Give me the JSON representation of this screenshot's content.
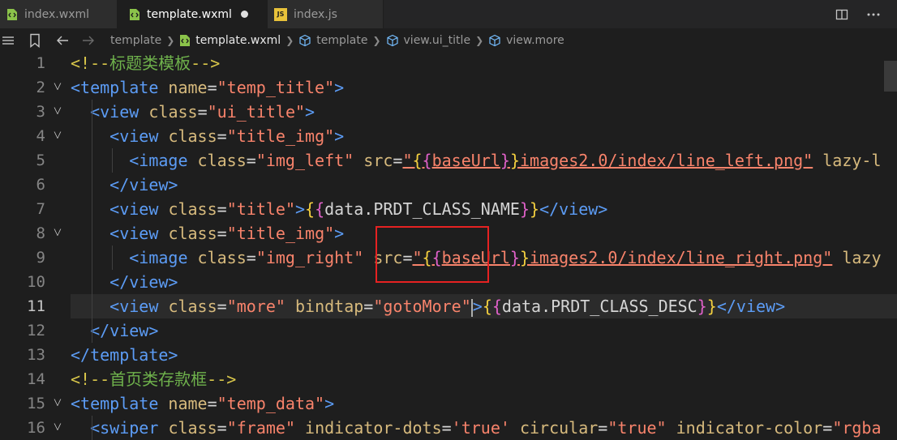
{
  "tabs": [
    {
      "label": "index.wxml",
      "icon": "wxml-file-icon",
      "active": false,
      "modified": false
    },
    {
      "label": "template.wxml",
      "icon": "wxml-file-icon",
      "active": true,
      "modified": true
    },
    {
      "label": "index.js",
      "icon": "js-file-icon",
      "active": false,
      "modified": false
    }
  ],
  "js_badge": "JS",
  "breadcrumb": {
    "items": [
      "template",
      "template.wxml",
      "template",
      "view.ui_title",
      "view.more"
    ]
  },
  "editor": {
    "current_line": 11,
    "lines": [
      {
        "n": "1",
        "tokens": [
          [
            "cmt",
            "<!--"
          ],
          [
            "cmtzh",
            "标题类模板"
          ],
          [
            "cmt",
            "-->"
          ]
        ]
      },
      {
        "n": "2",
        "fold": true,
        "tokens": [
          [
            "tag",
            "<template"
          ],
          [
            "txt",
            " "
          ],
          [
            "attr",
            "name"
          ],
          [
            "txt",
            "="
          ],
          [
            "val",
            "\"temp_title\""
          ],
          [
            "tag",
            ">"
          ]
        ]
      },
      {
        "n": "3",
        "fold": true,
        "tokens": [
          [
            "txt",
            "  "
          ],
          [
            "tag",
            "<view"
          ],
          [
            "txt",
            " "
          ],
          [
            "attr",
            "class"
          ],
          [
            "txt",
            "="
          ],
          [
            "val",
            "\"ui_title\""
          ],
          [
            "tag",
            ">"
          ]
        ]
      },
      {
        "n": "4",
        "fold": true,
        "tokens": [
          [
            "txt",
            "    "
          ],
          [
            "tag",
            "<view"
          ],
          [
            "txt",
            " "
          ],
          [
            "attr",
            "class"
          ],
          [
            "txt",
            "="
          ],
          [
            "val",
            "\"title_img\""
          ],
          [
            "tag",
            ">"
          ]
        ]
      },
      {
        "n": "5",
        "tokens": [
          [
            "txt",
            "      "
          ],
          [
            "tag",
            "<image"
          ],
          [
            "txt",
            " "
          ],
          [
            "attr",
            "class"
          ],
          [
            "txt",
            "="
          ],
          [
            "val",
            "\"img_left\""
          ],
          [
            "txt",
            " "
          ],
          [
            "attr",
            "src"
          ],
          [
            "txt",
            "="
          ],
          [
            "valu",
            "\""
          ],
          [
            "br1u",
            "{"
          ],
          [
            "br2u",
            "{"
          ],
          [
            "valu",
            "baseUrl"
          ],
          [
            "br2u",
            "}"
          ],
          [
            "br1u",
            "}"
          ],
          [
            "valu",
            "images2.0/index/line_left.png\""
          ],
          [
            "txt",
            " "
          ],
          [
            "attr",
            "lazy-l"
          ]
        ]
      },
      {
        "n": "6",
        "tokens": [
          [
            "txt",
            "    "
          ],
          [
            "tag",
            "</view>"
          ]
        ]
      },
      {
        "n": "7",
        "tokens": [
          [
            "txt",
            "    "
          ],
          [
            "tag",
            "<view"
          ],
          [
            "txt",
            " "
          ],
          [
            "attr",
            "class"
          ],
          [
            "txt",
            "="
          ],
          [
            "val",
            "\"title\""
          ],
          [
            "tag",
            ">"
          ],
          [
            "br1",
            "{"
          ],
          [
            "br2",
            "{"
          ],
          [
            "txt",
            "data.PRDT_CLASS_NAME"
          ],
          [
            "br2",
            "}"
          ],
          [
            "br1",
            "}"
          ],
          [
            "tag",
            "</view>"
          ]
        ]
      },
      {
        "n": "8",
        "fold": true,
        "tokens": [
          [
            "txt",
            "    "
          ],
          [
            "tag",
            "<view"
          ],
          [
            "txt",
            " "
          ],
          [
            "attr",
            "class"
          ],
          [
            "txt",
            "="
          ],
          [
            "val",
            "\"title_img\""
          ],
          [
            "tag",
            ">"
          ]
        ]
      },
      {
        "n": "9",
        "tokens": [
          [
            "txt",
            "      "
          ],
          [
            "tag",
            "<image"
          ],
          [
            "txt",
            " "
          ],
          [
            "attr",
            "class"
          ],
          [
            "txt",
            "="
          ],
          [
            "val",
            "\"img_right\""
          ],
          [
            "txt",
            " "
          ],
          [
            "attr",
            "src"
          ],
          [
            "txt",
            "="
          ],
          [
            "valu",
            "\""
          ],
          [
            "br1u",
            "{"
          ],
          [
            "br2u",
            "{"
          ],
          [
            "valu",
            "baseUrl"
          ],
          [
            "br2u",
            "}"
          ],
          [
            "br1u",
            "}"
          ],
          [
            "valu",
            "images2.0/index/line_right.png\""
          ],
          [
            "txt",
            " "
          ],
          [
            "attr",
            "lazy"
          ]
        ]
      },
      {
        "n": "10",
        "tokens": [
          [
            "txt",
            "    "
          ],
          [
            "tag",
            "</view>"
          ]
        ]
      },
      {
        "n": "11",
        "tokens": [
          [
            "txt",
            "    "
          ],
          [
            "tag",
            "<view"
          ],
          [
            "txt",
            " "
          ],
          [
            "attr",
            "class"
          ],
          [
            "txt",
            "="
          ],
          [
            "val",
            "\"more\""
          ],
          [
            "txt",
            " "
          ],
          [
            "attr",
            "bindtap"
          ],
          [
            "txt",
            "="
          ],
          [
            "val",
            "\"gotoMore\""
          ],
          [
            "cursor",
            ""
          ],
          [
            "tag",
            ">"
          ],
          [
            "br1",
            "{"
          ],
          [
            "br2",
            "{"
          ],
          [
            "txt",
            "data.PRDT_CLASS_DESC"
          ],
          [
            "br2",
            "}"
          ],
          [
            "br1",
            "}"
          ],
          [
            "tag",
            "</view>"
          ]
        ]
      },
      {
        "n": "12",
        "tokens": [
          [
            "txt",
            "  "
          ],
          [
            "tag",
            "</view>"
          ]
        ]
      },
      {
        "n": "13",
        "tokens": [
          [
            "tag",
            "</template>"
          ]
        ]
      },
      {
        "n": "14",
        "tokens": [
          [
            "cmt",
            "<!--"
          ],
          [
            "cmtzh",
            "首页类存款框"
          ],
          [
            "cmt",
            "-->"
          ]
        ]
      },
      {
        "n": "15",
        "fold": true,
        "tokens": [
          [
            "tag",
            "<template"
          ],
          [
            "txt",
            " "
          ],
          [
            "attr",
            "name"
          ],
          [
            "txt",
            "="
          ],
          [
            "val",
            "\"temp_data\""
          ],
          [
            "tag",
            ">"
          ]
        ]
      },
      {
        "n": "16",
        "fold": true,
        "tokens": [
          [
            "txt",
            "  "
          ],
          [
            "tag",
            "<swiper"
          ],
          [
            "txt",
            " "
          ],
          [
            "attr",
            "class"
          ],
          [
            "txt",
            "="
          ],
          [
            "val",
            "\"frame\""
          ],
          [
            "txt",
            " "
          ],
          [
            "attr",
            "indicator-dots"
          ],
          [
            "txt",
            "="
          ],
          [
            "val",
            "'true'"
          ],
          [
            "txt",
            " "
          ],
          [
            "attr",
            "circular"
          ],
          [
            "txt",
            "="
          ],
          [
            "val",
            "\"true\""
          ],
          [
            "txt",
            " "
          ],
          [
            "attr",
            "indicator-color"
          ],
          [
            "txt",
            "="
          ],
          [
            "val",
            "\"rgba"
          ]
        ]
      }
    ]
  }
}
